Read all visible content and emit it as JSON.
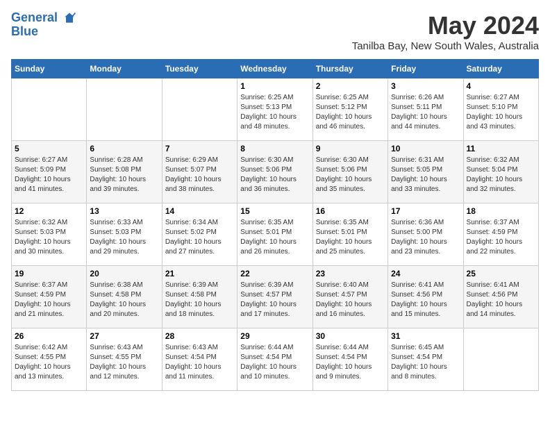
{
  "logo": {
    "line1": "General",
    "line2": "Blue"
  },
  "title": "May 2024",
  "location": "Tanilba Bay, New South Wales, Australia",
  "days_of_week": [
    "Sunday",
    "Monday",
    "Tuesday",
    "Wednesday",
    "Thursday",
    "Friday",
    "Saturday"
  ],
  "weeks": [
    [
      {
        "day": "",
        "sunrise": "",
        "sunset": "",
        "daylight": ""
      },
      {
        "day": "",
        "sunrise": "",
        "sunset": "",
        "daylight": ""
      },
      {
        "day": "",
        "sunrise": "",
        "sunset": "",
        "daylight": ""
      },
      {
        "day": "1",
        "sunrise": "Sunrise: 6:25 AM",
        "sunset": "Sunset: 5:13 PM",
        "daylight": "Daylight: 10 hours and 48 minutes."
      },
      {
        "day": "2",
        "sunrise": "Sunrise: 6:25 AM",
        "sunset": "Sunset: 5:12 PM",
        "daylight": "Daylight: 10 hours and 46 minutes."
      },
      {
        "day": "3",
        "sunrise": "Sunrise: 6:26 AM",
        "sunset": "Sunset: 5:11 PM",
        "daylight": "Daylight: 10 hours and 44 minutes."
      },
      {
        "day": "4",
        "sunrise": "Sunrise: 6:27 AM",
        "sunset": "Sunset: 5:10 PM",
        "daylight": "Daylight: 10 hours and 43 minutes."
      }
    ],
    [
      {
        "day": "5",
        "sunrise": "Sunrise: 6:27 AM",
        "sunset": "Sunset: 5:09 PM",
        "daylight": "Daylight: 10 hours and 41 minutes."
      },
      {
        "day": "6",
        "sunrise": "Sunrise: 6:28 AM",
        "sunset": "Sunset: 5:08 PM",
        "daylight": "Daylight: 10 hours and 39 minutes."
      },
      {
        "day": "7",
        "sunrise": "Sunrise: 6:29 AM",
        "sunset": "Sunset: 5:07 PM",
        "daylight": "Daylight: 10 hours and 38 minutes."
      },
      {
        "day": "8",
        "sunrise": "Sunrise: 6:30 AM",
        "sunset": "Sunset: 5:06 PM",
        "daylight": "Daylight: 10 hours and 36 minutes."
      },
      {
        "day": "9",
        "sunrise": "Sunrise: 6:30 AM",
        "sunset": "Sunset: 5:06 PM",
        "daylight": "Daylight: 10 hours and 35 minutes."
      },
      {
        "day": "10",
        "sunrise": "Sunrise: 6:31 AM",
        "sunset": "Sunset: 5:05 PM",
        "daylight": "Daylight: 10 hours and 33 minutes."
      },
      {
        "day": "11",
        "sunrise": "Sunrise: 6:32 AM",
        "sunset": "Sunset: 5:04 PM",
        "daylight": "Daylight: 10 hours and 32 minutes."
      }
    ],
    [
      {
        "day": "12",
        "sunrise": "Sunrise: 6:32 AM",
        "sunset": "Sunset: 5:03 PM",
        "daylight": "Daylight: 10 hours and 30 minutes."
      },
      {
        "day": "13",
        "sunrise": "Sunrise: 6:33 AM",
        "sunset": "Sunset: 5:03 PM",
        "daylight": "Daylight: 10 hours and 29 minutes."
      },
      {
        "day": "14",
        "sunrise": "Sunrise: 6:34 AM",
        "sunset": "Sunset: 5:02 PM",
        "daylight": "Daylight: 10 hours and 27 minutes."
      },
      {
        "day": "15",
        "sunrise": "Sunrise: 6:35 AM",
        "sunset": "Sunset: 5:01 PM",
        "daylight": "Daylight: 10 hours and 26 minutes."
      },
      {
        "day": "16",
        "sunrise": "Sunrise: 6:35 AM",
        "sunset": "Sunset: 5:01 PM",
        "daylight": "Daylight: 10 hours and 25 minutes."
      },
      {
        "day": "17",
        "sunrise": "Sunrise: 6:36 AM",
        "sunset": "Sunset: 5:00 PM",
        "daylight": "Daylight: 10 hours and 23 minutes."
      },
      {
        "day": "18",
        "sunrise": "Sunrise: 6:37 AM",
        "sunset": "Sunset: 4:59 PM",
        "daylight": "Daylight: 10 hours and 22 minutes."
      }
    ],
    [
      {
        "day": "19",
        "sunrise": "Sunrise: 6:37 AM",
        "sunset": "Sunset: 4:59 PM",
        "daylight": "Daylight: 10 hours and 21 minutes."
      },
      {
        "day": "20",
        "sunrise": "Sunrise: 6:38 AM",
        "sunset": "Sunset: 4:58 PM",
        "daylight": "Daylight: 10 hours and 20 minutes."
      },
      {
        "day": "21",
        "sunrise": "Sunrise: 6:39 AM",
        "sunset": "Sunset: 4:58 PM",
        "daylight": "Daylight: 10 hours and 18 minutes."
      },
      {
        "day": "22",
        "sunrise": "Sunrise: 6:39 AM",
        "sunset": "Sunset: 4:57 PM",
        "daylight": "Daylight: 10 hours and 17 minutes."
      },
      {
        "day": "23",
        "sunrise": "Sunrise: 6:40 AM",
        "sunset": "Sunset: 4:57 PM",
        "daylight": "Daylight: 10 hours and 16 minutes."
      },
      {
        "day": "24",
        "sunrise": "Sunrise: 6:41 AM",
        "sunset": "Sunset: 4:56 PM",
        "daylight": "Daylight: 10 hours and 15 minutes."
      },
      {
        "day": "25",
        "sunrise": "Sunrise: 6:41 AM",
        "sunset": "Sunset: 4:56 PM",
        "daylight": "Daylight: 10 hours and 14 minutes."
      }
    ],
    [
      {
        "day": "26",
        "sunrise": "Sunrise: 6:42 AM",
        "sunset": "Sunset: 4:55 PM",
        "daylight": "Daylight: 10 hours and 13 minutes."
      },
      {
        "day": "27",
        "sunrise": "Sunrise: 6:43 AM",
        "sunset": "Sunset: 4:55 PM",
        "daylight": "Daylight: 10 hours and 12 minutes."
      },
      {
        "day": "28",
        "sunrise": "Sunrise: 6:43 AM",
        "sunset": "Sunset: 4:54 PM",
        "daylight": "Daylight: 10 hours and 11 minutes."
      },
      {
        "day": "29",
        "sunrise": "Sunrise: 6:44 AM",
        "sunset": "Sunset: 4:54 PM",
        "daylight": "Daylight: 10 hours and 10 minutes."
      },
      {
        "day": "30",
        "sunrise": "Sunrise: 6:44 AM",
        "sunset": "Sunset: 4:54 PM",
        "daylight": "Daylight: 10 hours and 9 minutes."
      },
      {
        "day": "31",
        "sunrise": "Sunrise: 6:45 AM",
        "sunset": "Sunset: 4:54 PM",
        "daylight": "Daylight: 10 hours and 8 minutes."
      },
      {
        "day": "",
        "sunrise": "",
        "sunset": "",
        "daylight": ""
      }
    ]
  ]
}
